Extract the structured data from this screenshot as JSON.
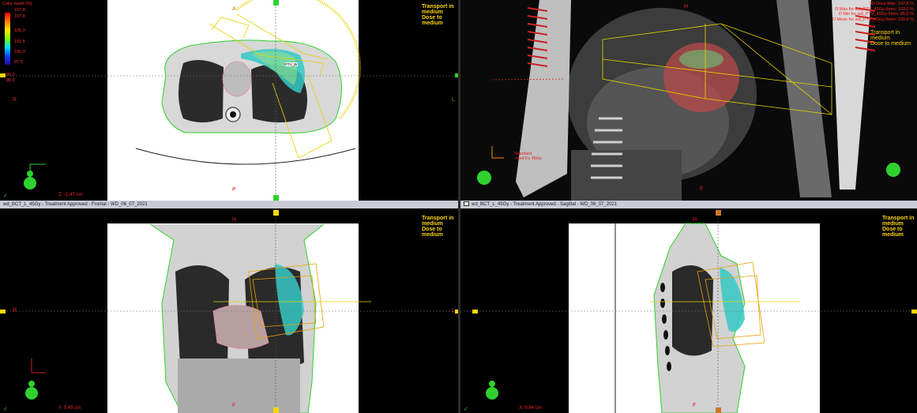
{
  "legend": {
    "title": "Color wash (%)",
    "stops": [
      "107.8",
      "107.8",
      "105.0",
      "102.5",
      "100.0",
      "97.5"
    ],
    "min_label": "85.0",
    "sub_label": "85.0"
  },
  "transport_note": {
    "line1": "Transport in",
    "line2": "medium",
    "line3": "Dose to medium"
  },
  "axial": {
    "orientation": {
      "top": "A",
      "bottom": "P",
      "left": "R",
      "right": "L"
    },
    "structure_label": "PTV_Br",
    "z_readout": "Z: -1.47 cm"
  },
  "view3d": {
    "orientation": {
      "top": "H",
      "bottom": "F"
    },
    "dose_readout": [
      "3D Dose Max: 107.8 %",
      "D Max for wd_PTV_45Gy-5mm: 103.0 %",
      "D Min for wd_PTV_45Gy-5mm: 85.5 %",
      "D Mean for wd_PTV_45Gy-5mm: 100.0 %"
    ],
    "transport_lines": [
      "Transport in",
      "medium",
      "Dose to medium"
    ],
    "annotation": [
      "Standard",
      "-med Fx 45Gy"
    ]
  },
  "frontal": {
    "titlebar": "wd_BCT_L_45Gy  -  Treatment Approved - Frontal - WD_06_07_2021",
    "orientation": {
      "top": "H",
      "bottom": "F",
      "left": "R",
      "right": "L"
    },
    "coord_readout": "Y: 5.45 cm"
  },
  "sagittal": {
    "titlebar": "wd_BCT_L_45Gy  -  Treatment Approved - Sagittal - WD_06_07_2021",
    "orientation": {
      "top": "H",
      "bottom": "F"
    },
    "coord_readout": "X: 9.94 cm"
  },
  "colors": {
    "label_yellow": "#ffd700",
    "label_red": "#e02020",
    "body_contour": "#2fd12f",
    "beam": "#e6d200"
  }
}
